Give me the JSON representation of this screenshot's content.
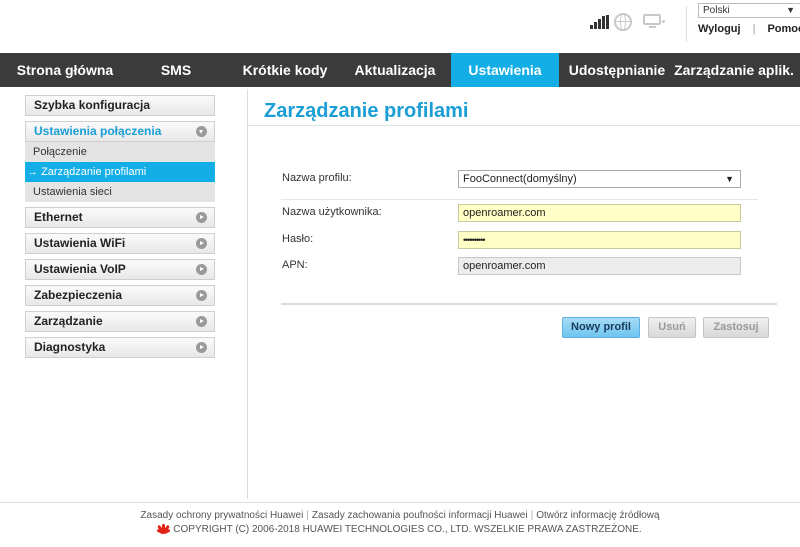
{
  "top": {
    "language": "Polski",
    "links": [
      "Wyloguj",
      "Pomoc"
    ]
  },
  "nav": {
    "tabs": [
      {
        "label": "Strona główna",
        "active": false
      },
      {
        "label": "SMS",
        "active": false
      },
      {
        "label": "Krótkie kody",
        "active": false
      },
      {
        "label": "Aktualizacja",
        "active": false
      },
      {
        "label": "Ustawienia",
        "active": true
      },
      {
        "label": "Udostępnianie",
        "active": false
      },
      {
        "label": "Zarządzanie aplik.",
        "active": false
      }
    ]
  },
  "sidebar": {
    "items": [
      {
        "label": "Szybka konfiguracja"
      },
      {
        "label": "Ustawienia połączenia",
        "open": true,
        "children": [
          {
            "label": "Połączenie"
          },
          {
            "label": "Zarządzanie profilami",
            "active": true
          },
          {
            "label": "Ustawienia sieci"
          }
        ]
      },
      {
        "label": "Ethernet"
      },
      {
        "label": "Ustawienia WiFi"
      },
      {
        "label": "Ustawienia VoIP"
      },
      {
        "label": "Zabezpieczenia"
      },
      {
        "label": "Zarządzanie"
      },
      {
        "label": "Diagnostyka"
      }
    ]
  },
  "main": {
    "title": "Zarządzanie profilami",
    "form": {
      "profile_label": "Nazwa profilu:",
      "profile_value": "FooConnect(domyślny)",
      "username_label": "Nazwa użytkownika:",
      "username_value": "openroamer.com",
      "password_label": "Hasło:",
      "password_value": "••••••••••",
      "apn_label": "APN:",
      "apn_value": "openroamer.com"
    },
    "buttons": {
      "new_profile": "Nowy profil",
      "delete": "Usuń",
      "apply": "Zastosuj"
    }
  },
  "footer": {
    "links": [
      "Zasady ochrony prywatności Huawei",
      "Zasady zachowania poufności informacji Huawei",
      "Otwórz informację źródłową"
    ],
    "copyright": "COPYRIGHT (C) 2006-2018 HUAWEI TECHNOLOGIES CO., LTD. WSZELKIE PRAWA ZASTRZEŻONE.",
    "accent": "#e2231a"
  },
  "colors": {
    "accent": "#14aee6",
    "title": "#1b9ed6",
    "nav_bg": "#3b3b3b"
  }
}
